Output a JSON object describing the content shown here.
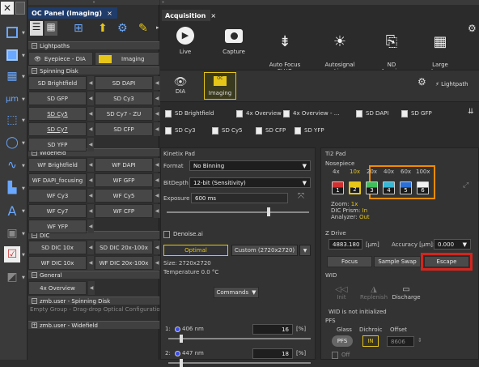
{
  "left_toolbar": {
    "icons": [
      "close-icon",
      "square-icon",
      "image-icon",
      "grid-icon",
      "measure-icon",
      "roi-icon",
      "ellipse-icon",
      "waveform-icon",
      "macro-icon",
      "text-icon",
      "check-icon"
    ]
  },
  "oc_panel": {
    "tab": "OC Panel (Imaging)",
    "tab_close": "×",
    "groups": {
      "lightpaths": "Lightpaths",
      "spinning": "Spinning Disk",
      "widefield": "Widefield",
      "dic": "DIC",
      "general": "General",
      "zmb_spin": "zmb.user - Spinning Disk",
      "zmb_wide": "zmb.user - Widefield"
    },
    "eyepiece": "Eyepiece - DIA",
    "imaging": "Imaging",
    "spinning_buttons": [
      "SD Brightfield",
      "SD DAPI",
      "SD GFP",
      "SD Cy3",
      "SD Cy5",
      "SD Cy7 - ZU",
      "SD Cy7",
      "SD CFP",
      "SD YFP"
    ],
    "widefield_buttons": [
      "WF Brightfield",
      "WF DAPI",
      "WF DAPI_focusing",
      "WF GFP",
      "WF Cy3",
      "WF Cy5",
      "WF Cy7",
      "WF CFP",
      "WF YFP"
    ],
    "dic_buttons": [
      "SD DIC 10x",
      "SD DIC 20x-100x",
      "WF DIC 10x",
      "WF DIC 20x-100x"
    ],
    "general_buttons": [
      "4x Overview"
    ],
    "empty_group": "Empty Group - Drag-drop Optical Configuration H"
  },
  "acquisition": {
    "tab": "Acquisition",
    "tab_close": "×",
    "tools": [
      "Live",
      "Capture",
      "Auto Focus\nFLUO",
      "Autosignal\nLive",
      "ND\nAcquire",
      "Large\nImage"
    ],
    "mode_dia": "DIA",
    "mode_imaging": "Imaging",
    "lightpath": "Lightpath",
    "oc_row1": [
      "SD Brightfield",
      "4x Overview",
      "4x Overview - ...",
      "SD DAPI",
      "SD GFP"
    ],
    "oc_row2": [
      "SD Cy3",
      "SD Cy5",
      "SD CFP",
      "SD YFP"
    ]
  },
  "kinetix": {
    "title": "Kinetix Pad",
    "format_label": "Format",
    "format_value": "No Binning",
    "bitdepth_label": "BitDepth",
    "bitdepth_value": "12-bit (Sensitivity)",
    "exposure_label": "Exposure",
    "exposure_value": "600 ms",
    "denoise": "Denoise.ai",
    "optimal": "Optimal",
    "custom": "Custom (2720x2720)",
    "size": "Size: 2720x2720",
    "temperature": "Temperature 0.0 °C",
    "commands": "Commands"
  },
  "lasers": [
    {
      "idx": "1:",
      "wavelength": "406 nm",
      "value": "16",
      "unit": "[%]"
    },
    {
      "idx": "2:",
      "wavelength": "447 nm",
      "value": "18",
      "unit": "[%]"
    }
  ],
  "ti2": {
    "title": "Ti2 Pad",
    "nosepiece": "Nosepiece",
    "objectives": [
      {
        "mag": "4x",
        "pos": "1",
        "color": "#d32f2f"
      },
      {
        "mag": "10x",
        "pos": "2",
        "color": "#e6c619"
      },
      {
        "mag": "20x",
        "pos": "3",
        "color": "#3fbf5a"
      },
      {
        "mag": "40x",
        "pos": "4",
        "color": "#35b7d6"
      },
      {
        "mag": "60x",
        "pos": "5",
        "color": "#2b6fd8"
      },
      {
        "mag": "100x",
        "pos": "6",
        "color": "#f2f2f2"
      }
    ],
    "zoom": "Zoom:",
    "zoom_val": "1x",
    "dic_prism": "DIC Prism:",
    "dic_prism_val": "In",
    "analyzer": "Analyzer:",
    "analyzer_val": "Out",
    "zdrive": "Z Drive",
    "z_value": "4883.180",
    "z_unit": "[µm]",
    "accuracy_label": "Accuracy [µm]:",
    "accuracy_value": "0.000",
    "focus": "Focus",
    "sample_swap": "Sample Swap",
    "escape": "Escape",
    "wid": "WID",
    "init": "Init",
    "replenish": "Replenish",
    "discharge": "Discharge",
    "wid_status": "WID is not initialized",
    "pfs": "PFS",
    "glass": "Glass",
    "dichroic": "Dichroic",
    "offset": "Offset",
    "pfs_btn": "PFS",
    "in_btn": "IN",
    "offset_val": "8606",
    "off": "Off"
  },
  "colors": {
    "highlight_orange": "#f28c00",
    "highlight_red": "#d1261f",
    "active_yellow": "#e6c619"
  }
}
